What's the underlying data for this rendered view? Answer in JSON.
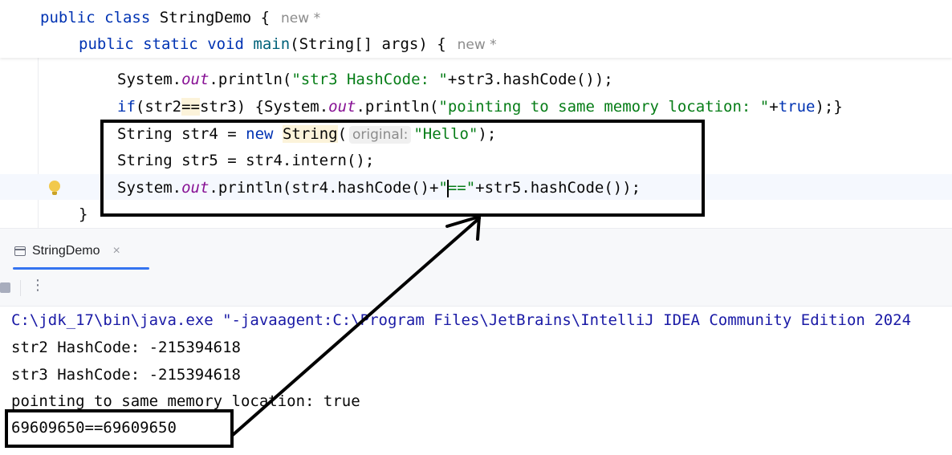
{
  "editor": {
    "class_line": {
      "kw1": "public",
      "kw2": "class",
      "name": "StringDemo",
      "brace": " {",
      "inlay": "new *"
    },
    "main_line": {
      "kw1": "public",
      "kw2": "static",
      "kw3": "void",
      "name": "main",
      "params": "(String[] args) {",
      "inlay": "new *"
    },
    "line3": {
      "a": "System.",
      "field": "out",
      "b": ".println(",
      "str": "\"str3 HashCode: \"",
      "c": "+str3.hashCode());"
    },
    "line4": {
      "kw": "if",
      "a": "(str2",
      "op": "==",
      "b": "str3) {System.",
      "field": "out",
      "c": ".println(",
      "str": "\"pointing to same memory location: \"",
      "d": "+",
      "kw2": "true",
      "e": ");}"
    },
    "line5": {
      "a": "String str4 = ",
      "kw": "new",
      "sp": " ",
      "cls": "String",
      "paren": "(",
      "hint": "original:",
      "str": "\"Hello\"",
      "end": ");"
    },
    "line6": {
      "text": "String str5 = str4.intern();"
    },
    "line7": {
      "a": "System.",
      "field": "out",
      "b": ".println(str4.hashCode()+",
      "str1": "\"",
      "str2": "==\"",
      "c": "+str5.hashCode());"
    },
    "line8": {
      "text": "}"
    }
  },
  "run_panel": {
    "tab_label": "StringDemo",
    "close_label": "×",
    "more_label": "⋮",
    "console": [
      "C:\\jdk_17\\bin\\java.exe \"-javaagent:C:\\Program Files\\JetBrains\\IntelliJ IDEA Community Edition 2024",
      "str2 HashCode: -215394618",
      "str3 HashCode: -215394618",
      "pointing to same memory location: true",
      "69609650==69609650"
    ]
  },
  "colors": {
    "keyword": "#0033b3",
    "string": "#067d17",
    "field": "#871094",
    "accent": "#3574f0",
    "annotation": "#000000"
  },
  "icons": [
    "run-config-icon",
    "close-icon",
    "stop-icon",
    "more-options-icon",
    "intention-bulb-icon"
  ]
}
